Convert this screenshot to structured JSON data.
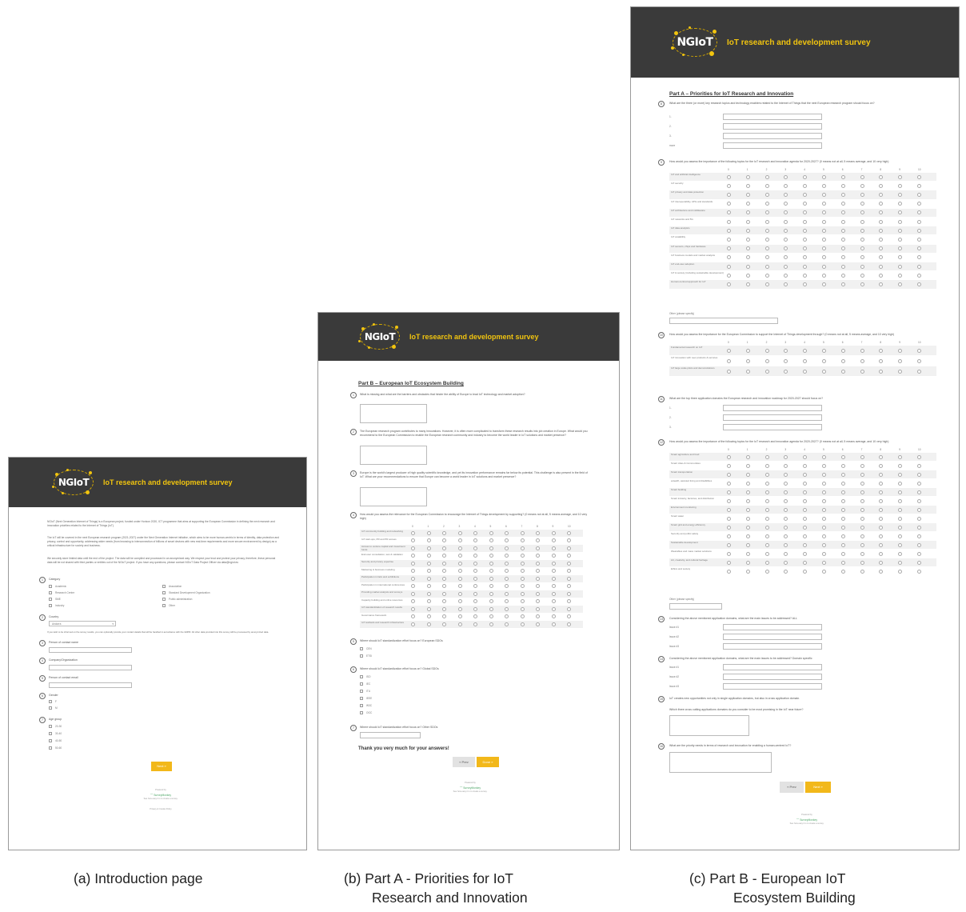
{
  "survey": {
    "logo_text": "NGIoT",
    "title": "IoT research and development survey"
  },
  "panel_a": {
    "intro_paragraphs": [
      "NGIoT (Next Generation Internet of Things) is a European project, funded under Horizon 2020, ICT programme that aims at supporting the European Commission in defining the next research and innovation priorities related to the Internet of Things (IoT).",
      "The IoT will be covered in the next European research program (2021-2027) under the Next Generation Internet initiative, which aims to be more human-centric in terms of identity, data protection and privacy, control and opportunity, addressing wider needs (from browsing to interconnection of billions of smart devices with new real-time requirements and more secure environment by design) as a critical infrastructure for society and business.",
      "We securely store limited data until the end of the project. The data will be compiled and processed in an anonymised way. We respect your trust and protect your privacy, therefore, these personal data will be not shared with third parties or entities out of the NGIoT project. If you have any questions, please contact NGIoT Data Project Officer via data@ngiot.eu"
    ],
    "q_category": "Category",
    "categories_left": [
      "Academic",
      "Research Centre",
      "SME",
      "Industry"
    ],
    "categories_right": [
      "Association",
      "Standard Development Organization",
      "Public administration",
      "Other"
    ],
    "q_country": "Country",
    "country_value": "Andorra",
    "optional_note": "If you wish to be informed on the survey results, you can optionally provide your contact details that will be handled in accordance with the GDPR. All other data provided into this survey will be processed by anonymized data.",
    "q_name": "Person of contact name",
    "q_company": "Company/Organization",
    "q_email": "Person of contact email",
    "q_gender": "Gender",
    "genders": [
      "F",
      "M"
    ],
    "q_age": "Age group",
    "ages": [
      "20-30",
      "30-40",
      "40-50",
      "50-60"
    ],
    "next_label": "Next »",
    "powered_by": "Powered by",
    "surveymonkey": "SurveyMonkey",
    "see_how": "See how easy it is to create a survey.",
    "privacy": "Privacy & Cookie Policy"
  },
  "panel_b": {
    "section_title": "Part B – European IoT Ecosystem Building",
    "q1": "What is missing and what are the barriers and obstacles that hinder the ability of Europe to lead IoT technology and market adoption?",
    "q2": "The European research program contributes to many innovations. However, it is often more complicated to transform these research results into job creation in Europe. What would you recommend to the European Commission to enable the European research community and industry to become the world leader in IoT solutions and market presence?",
    "q3": "Europe is the world's largest producer of high quality scientific knowledge, and yet its innovation performance remains far below its potential. This challenge is also present in the field of IoT. What are your recommendations to ensure that Europe can become a world leader in IoT solutions and market presence?",
    "q4": "How would you assess the relevance for the European Commission to encourage the Internet of Things development by supporting? (0 means not at all, 5 means average, and 10 very high)",
    "scale": [
      "0",
      "1",
      "2",
      "3",
      "4",
      "5",
      "6",
      "7",
      "8",
      "9",
      "10"
    ],
    "rows": [
      "IoT community building and networking",
      "IoT start-ups, PR and PR access",
      "Access to venture capital and investment funds",
      "End-user consultation, test & validation",
      "Security and privacy expertise",
      "Marketing & business modeling",
      "Participation in fairs and exhibitions",
      "Participation in international conferences",
      "Providing market analysis and surveys",
      "Capacity building and online resources",
      "IoT standardization of research results",
      "Governance framework",
      "IoT testbeds and research infrastructure"
    ],
    "q5": "Where should IoT standardization effort focus on? European SDOs",
    "q5_opts": [
      "CEN",
      "ETSI"
    ],
    "q6": "Where should IoT standardization effort focus on? Global SDOs",
    "q6_opts": [
      "ISO",
      "IEC",
      "ITU",
      "IEEE",
      "W3C",
      "OGC"
    ],
    "q7": "Where should IoT standardization effort focus on? Other SDOs",
    "thanks": "Thank you very much for your answers!",
    "prev_label": "« Prev",
    "done_label": "Done »",
    "powered_by": "Powered by",
    "surveymonkey": "SurveyMonkey",
    "see_how": "See how easy it is to create a survey."
  },
  "panel_c": {
    "section_title": "Part A – Priorities for IoT Research and Innovation",
    "q1": "What are the three (or more) key research topics and technology enablers related to the Internet of Things that the next European research program should focus on?",
    "q1_labels": [
      "1.",
      "2.",
      "3.",
      "more"
    ],
    "q2": "How would you assess the importance of the following topics for the IoT research and innovation agenda for 2020-2027? (0 means not at all, 5 means average, and 10 very high)",
    "scale": [
      "0",
      "1",
      "2",
      "3",
      "4",
      "5",
      "6",
      "7",
      "8",
      "9",
      "10"
    ],
    "q2_rows": [
      "IoT and artificial intelligence",
      "IoT security",
      "IoT privacy and data protection",
      "IoT interoperability, APIs and standards",
      "IoT architecture and middleware",
      "IoT networks and 5G",
      "IoT data analytics",
      "IoT scalability",
      "IoT sensors, chips and hardware",
      "IoT business models and market analysis",
      "IoT end-user adoption",
      "IoT & society (including sustainable development)",
      "Human-centred approach for IoT"
    ],
    "other_specify": "Other (please specify)",
    "q3": "How would you assess the importance for the European Commission to support the Internet of Things development through? (0 means not at all, 5 means average, and 10 very high)",
    "q3_rows": [
      "Fundamental research on IoT",
      "IoT innovation with new products & services",
      "IoT large scale pilots and demonstrations"
    ],
    "q4": "What are the top three application domains the European research and innovation roadmap for 2020-2027 should focus on?",
    "q4_labels": [
      "1.",
      "2.",
      "3."
    ],
    "q5": "How would you assess the importance of the following topics for the IoT research and innovation agenda for 2020-2027? (0 means not at all, 5 means average, and 10 very high)",
    "q5_rows": [
      "Smart agriculture and food",
      "Smart cities & Communities",
      "Smart transportation",
      "eHealth, assisted living and disabilities",
      "Smart building",
      "Smart industry, factories, and distribution",
      "Environment monitoring",
      "Smart water",
      "Smart grid and energy efficiency",
      "Security and public safety",
      "Sustainable development",
      "Wearables and mass market solutions",
      "Art, creativity, and cultural heritage",
      "Ethics and society"
    ],
    "q6": "Considering the above mentioned application domains, what are the main issues to be addressed? ALL",
    "issue_labels": [
      "Issue #1",
      "Issue #2",
      "Issue #3"
    ],
    "q7": "Considering the above mentioned application domains, what are the main issues to be addressed? Domain specific",
    "q8": "IoT creates new opportunities not only in single application domains, but also in cross application domain.",
    "q8b": "Which three cross cutting applications domains do you consider to be most promising in the IoT near future?",
    "q9": "What are the priority needs in terms of research and innovation for enabling a human-centred IoT?",
    "prev_label": "« Prev",
    "next_label": "Next »",
    "powered_by": "Powered by",
    "surveymonkey": "SurveyMonkey",
    "see_how": "See how easy it is to create a survey."
  },
  "captions": {
    "a": "(a)   Introduction page",
    "b1": "(b)   Part A - Priorities for IoT",
    "b2": "Research and Innovation",
    "c1": "(c)   Part B - European IoT",
    "c2": "Ecosystem Building"
  },
  "colors": {
    "header_bg": "#3a3a3a",
    "accent_yellow": "#f1c40f",
    "button_yellow": "#f2b81a"
  }
}
